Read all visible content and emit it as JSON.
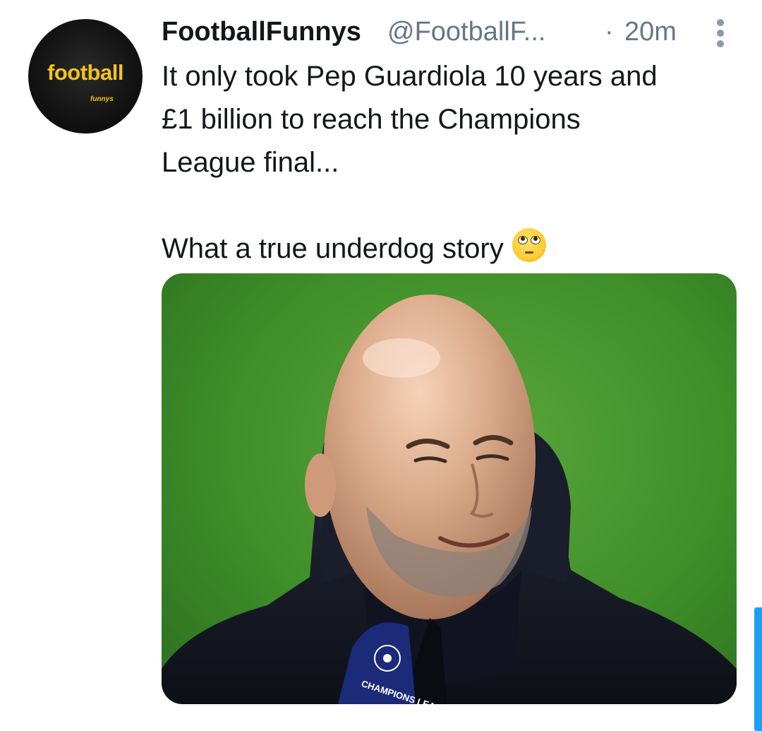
{
  "tweet": {
    "avatar": {
      "logo_text": "football",
      "logo_sub": "funnys"
    },
    "display_name": "FootballFunnys",
    "handle": "@FootballF...",
    "separator": "·",
    "time": "20m",
    "menu_icon": "more-vertical-icon",
    "text": "It only took Pep Guardiola 10 years and\n£1 billion to reach the Champions\nLeague final...\n\nWhat a true underdog story",
    "emoji": "face-with-rolling-eyes",
    "media": {
      "mic_flag_text": "CHAMPIONS LEAGUE"
    }
  },
  "colors": {
    "name": "#14171a",
    "secondary": "#657786",
    "logo": "#f4c21b",
    "accent": "#1da1f2"
  }
}
